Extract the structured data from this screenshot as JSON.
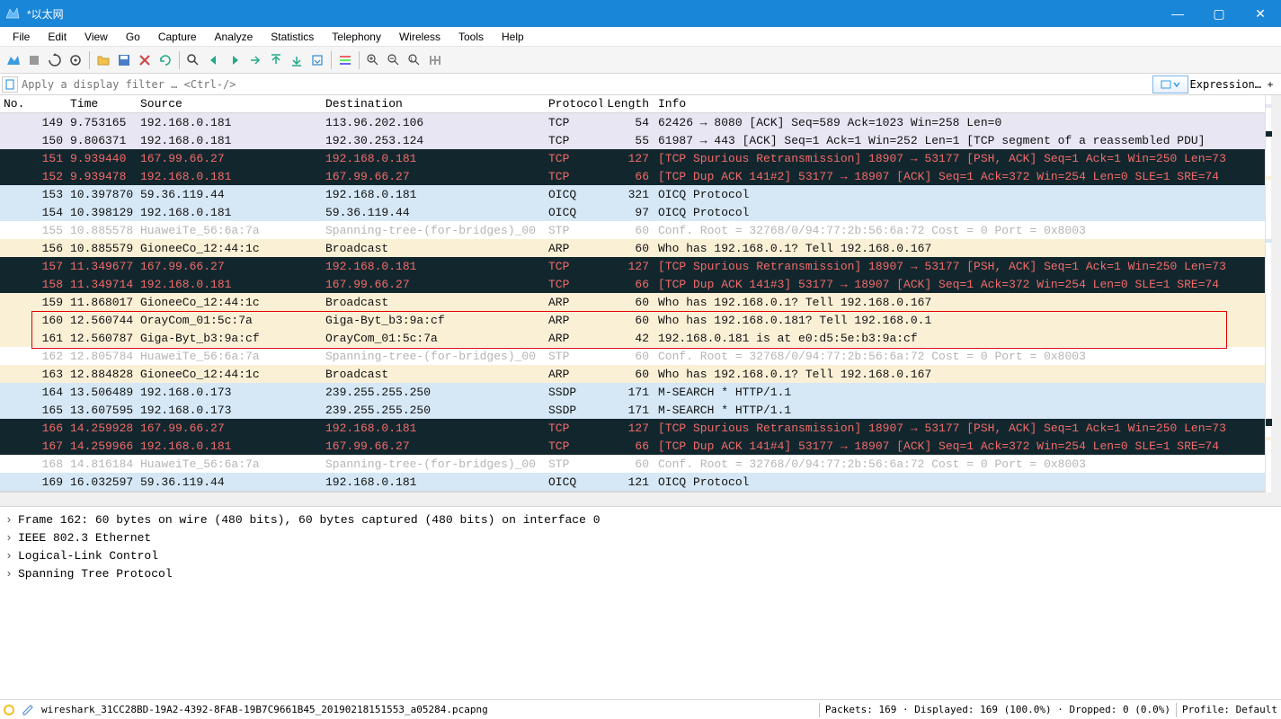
{
  "window_title": "*以太网",
  "menu": [
    "File",
    "Edit",
    "View",
    "Go",
    "Capture",
    "Analyze",
    "Statistics",
    "Telephony",
    "Wireless",
    "Tools",
    "Help"
  ],
  "filter": {
    "placeholder": "Apply a display filter … <Ctrl-/>",
    "expression_label": "Expression…",
    "plus": "+"
  },
  "columns": {
    "no": "No.",
    "time": "Time",
    "source": "Source",
    "destination": "Destination",
    "protocol": "Protocol",
    "length": "Length",
    "info": "Info"
  },
  "packets": [
    {
      "no": "149",
      "time": "9.753165",
      "src": "192.168.0.181",
      "dst": "113.96.202.106",
      "prt": "TCP",
      "len": "54",
      "info": "62426 → 8080 [ACK] Seq=589 Ack=1023 Win=258 Len=0",
      "cls": "row-light"
    },
    {
      "no": "150",
      "time": "9.806371",
      "src": "192.168.0.181",
      "dst": "192.30.253.124",
      "prt": "TCP",
      "len": "55",
      "info": "61987 → 443 [ACK] Seq=1 Ack=1 Win=252 Len=1 [TCP segment of a reassembled PDU]",
      "cls": "row-light"
    },
    {
      "no": "151",
      "time": "9.939440",
      "src": "167.99.66.27",
      "dst": "192.168.0.181",
      "prt": "TCP",
      "len": "127",
      "info": "[TCP Spurious Retransmission] 18907 → 53177 [PSH, ACK] Seq=1 Ack=1 Win=250 Len=73",
      "cls": "row-dark"
    },
    {
      "no": "152",
      "time": "9.939478",
      "src": "192.168.0.181",
      "dst": "167.99.66.27",
      "prt": "TCP",
      "len": "66",
      "info": "[TCP Dup ACK 141#2] 53177 → 18907 [ACK] Seq=1 Ack=372 Win=254 Len=0 SLE=1 SRE=74",
      "cls": "row-dark"
    },
    {
      "no": "153",
      "time": "10.397870",
      "src": "59.36.119.44",
      "dst": "192.168.0.181",
      "prt": "OICQ",
      "len": "321",
      "info": "OICQ Protocol",
      "cls": "row-blue"
    },
    {
      "no": "154",
      "time": "10.398129",
      "src": "192.168.0.181",
      "dst": "59.36.119.44",
      "prt": "OICQ",
      "len": "97",
      "info": "OICQ Protocol",
      "cls": "row-blue"
    },
    {
      "no": "155",
      "time": "10.885578",
      "src": "HuaweiTe_56:6a:7a",
      "dst": "Spanning-tree-(for-bridges)_00",
      "prt": "STP",
      "len": "60",
      "info": "Conf. Root = 32768/0/94:77:2b:56:6a:72  Cost = 0  Port = 0x8003",
      "cls": "row-grey"
    },
    {
      "no": "156",
      "time": "10.885579",
      "src": "GioneeCo_12:44:1c",
      "dst": "Broadcast",
      "prt": "ARP",
      "len": "60",
      "info": "Who has 192.168.0.1? Tell 192.168.0.167",
      "cls": "row-tan"
    },
    {
      "no": "157",
      "time": "11.349677",
      "src": "167.99.66.27",
      "dst": "192.168.0.181",
      "prt": "TCP",
      "len": "127",
      "info": "[TCP Spurious Retransmission] 18907 → 53177 [PSH, ACK] Seq=1 Ack=1 Win=250 Len=73",
      "cls": "row-dark"
    },
    {
      "no": "158",
      "time": "11.349714",
      "src": "192.168.0.181",
      "dst": "167.99.66.27",
      "prt": "TCP",
      "len": "66",
      "info": "[TCP Dup ACK 141#3] 53177 → 18907 [ACK] Seq=1 Ack=372 Win=254 Len=0 SLE=1 SRE=74",
      "cls": "row-dark"
    },
    {
      "no": "159",
      "time": "11.868017",
      "src": "GioneeCo_12:44:1c",
      "dst": "Broadcast",
      "prt": "ARP",
      "len": "60",
      "info": "Who has 192.168.0.1? Tell 192.168.0.167",
      "cls": "row-tan"
    },
    {
      "no": "160",
      "time": "12.560744",
      "src": "OrayCom_01:5c:7a",
      "dst": "Giga-Byt_b3:9a:cf",
      "prt": "ARP",
      "len": "60",
      "info": "Who has 192.168.0.181? Tell 192.168.0.1",
      "cls": "row-tan"
    },
    {
      "no": "161",
      "time": "12.560787",
      "src": "Giga-Byt_b3:9a:cf",
      "dst": "OrayCom_01:5c:7a",
      "prt": "ARP",
      "len": "42",
      "info": "192.168.0.181 is at e0:d5:5e:b3:9a:cf",
      "cls": "row-tan"
    },
    {
      "no": "162",
      "time": "12.805784",
      "src": "HuaweiTe_56:6a:7a",
      "dst": "Spanning-tree-(for-bridges)_00",
      "prt": "STP",
      "len": "60",
      "info": "Conf. Root = 32768/0/94:77:2b:56:6a:72  Cost = 0  Port = 0x8003",
      "cls": "row-grey"
    },
    {
      "no": "163",
      "time": "12.884828",
      "src": "GioneeCo_12:44:1c",
      "dst": "Broadcast",
      "prt": "ARP",
      "len": "60",
      "info": "Who has 192.168.0.1? Tell 192.168.0.167",
      "cls": "row-tan"
    },
    {
      "no": "164",
      "time": "13.506489",
      "src": "192.168.0.173",
      "dst": "239.255.255.250",
      "prt": "SSDP",
      "len": "171",
      "info": "M-SEARCH * HTTP/1.1",
      "cls": "row-blue"
    },
    {
      "no": "165",
      "time": "13.607595",
      "src": "192.168.0.173",
      "dst": "239.255.255.250",
      "prt": "SSDP",
      "len": "171",
      "info": "M-SEARCH * HTTP/1.1",
      "cls": "row-blue"
    },
    {
      "no": "166",
      "time": "14.259928",
      "src": "167.99.66.27",
      "dst": "192.168.0.181",
      "prt": "TCP",
      "len": "127",
      "info": "[TCP Spurious Retransmission] 18907 → 53177 [PSH, ACK] Seq=1 Ack=1 Win=250 Len=73",
      "cls": "row-dark"
    },
    {
      "no": "167",
      "time": "14.259966",
      "src": "192.168.0.181",
      "dst": "167.99.66.27",
      "prt": "TCP",
      "len": "66",
      "info": "[TCP Dup ACK 141#4] 53177 → 18907 [ACK] Seq=1 Ack=372 Win=254 Len=0 SLE=1 SRE=74",
      "cls": "row-dark"
    },
    {
      "no": "168",
      "time": "14.816184",
      "src": "HuaweiTe_56:6a:7a",
      "dst": "Spanning-tree-(for-bridges)_00",
      "prt": "STP",
      "len": "60",
      "info": "Conf. Root = 32768/0/94:77:2b:56:6a:72  Cost = 0  Port = 0x8003",
      "cls": "row-grey"
    },
    {
      "no": "169",
      "time": "16.032597",
      "src": "59.36.119.44",
      "dst": "192.168.0.181",
      "prt": "OICQ",
      "len": "121",
      "info": "OICQ Protocol",
      "cls": "row-blue"
    }
  ],
  "details": [
    "Frame 162: 60 bytes on wire (480 bits), 60 bytes captured (480 bits) on interface 0",
    "IEEE 802.3 Ethernet",
    "Logical-Link Control",
    "Spanning Tree Protocol"
  ],
  "status": {
    "file": "wireshark_31CC28BD-19A2-4392-8FAB-19B7C9661B45_20190218151553_a05284.pcapng",
    "packets": "Packets: 169 · Displayed: 169 (100.0%) · Dropped: 0 (0.0%)",
    "profile": "Profile: Default"
  }
}
